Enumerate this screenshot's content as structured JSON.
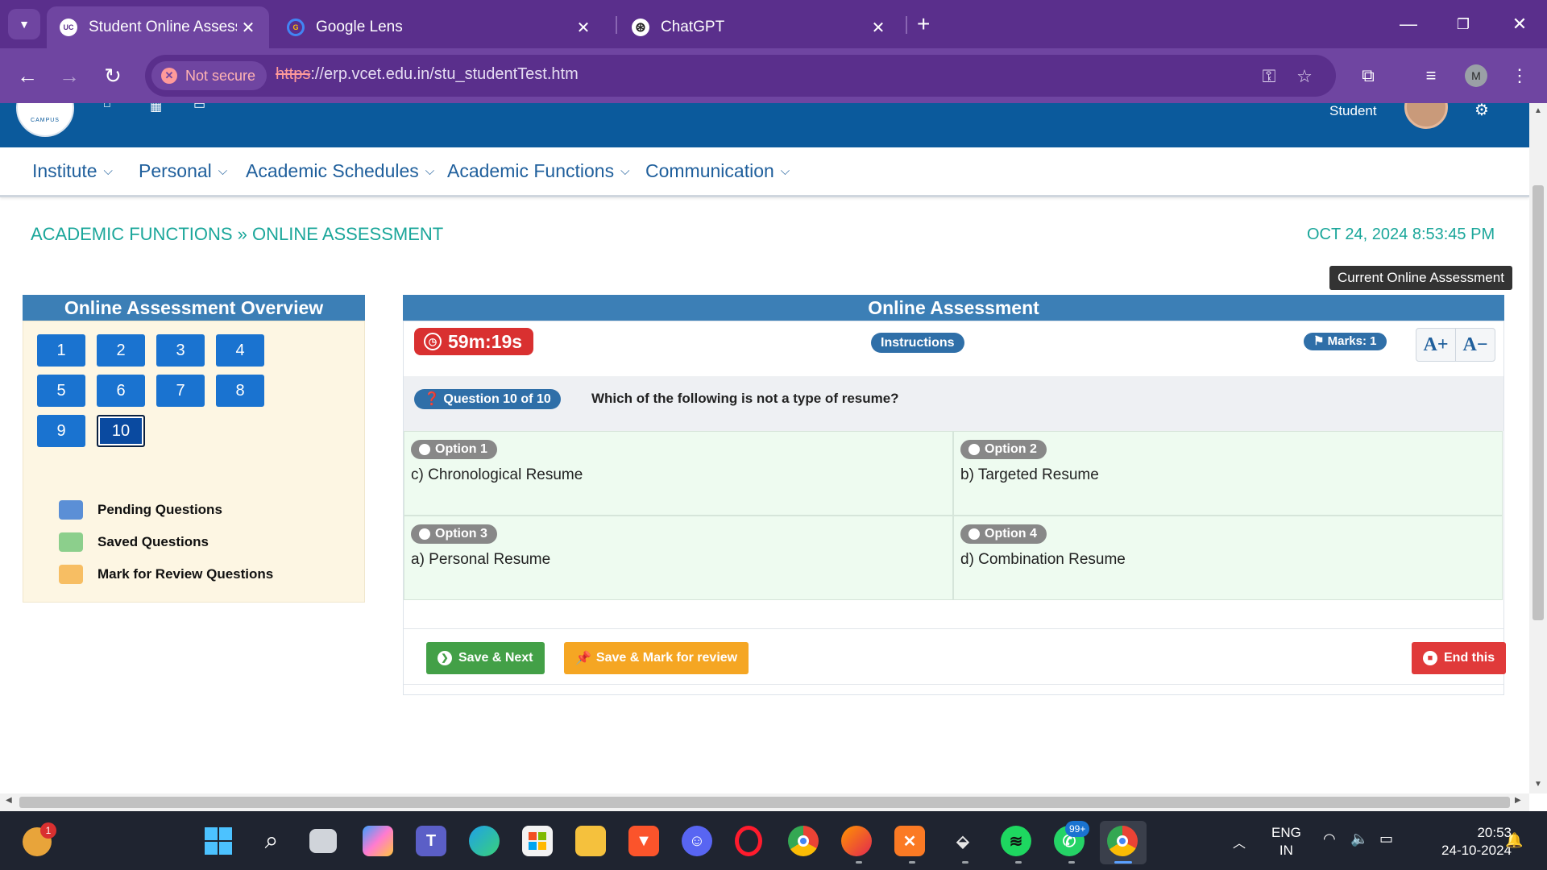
{
  "browser": {
    "tabs": [
      {
        "title": "Student Online Assessment",
        "favicon": "UC"
      },
      {
        "title": "Google Lens",
        "favicon": "G"
      },
      {
        "title": "ChatGPT",
        "favicon": "⊛"
      }
    ],
    "security_label": "Not secure",
    "url_scheme": "https",
    "url_rest": "://erp.vcet.edu.in/stu_studentTest.htm",
    "profile_initial": "M"
  },
  "header": {
    "logo_text": "CAMPUS",
    "student_label": "Student"
  },
  "menu": [
    {
      "label": "Institute"
    },
    {
      "label": "Personal"
    },
    {
      "label": "Academic Schedules"
    },
    {
      "label": "Academic Functions"
    },
    {
      "label": "Communication"
    }
  ],
  "breadcrumb": "ACADEMIC FUNCTIONS » ONLINE ASSESSMENT",
  "datetime": "OCT 24, 2024  8:53:45 PM",
  "current_assessment_label": "Current Online Assessment",
  "overview": {
    "title": "Online Assessment Overview",
    "questions": [
      "1",
      "2",
      "3",
      "4",
      "5",
      "6",
      "7",
      "8",
      "9",
      "10"
    ],
    "current": "10",
    "legend": [
      {
        "label": "Pending Questions",
        "color": "#5b8fd6"
      },
      {
        "label": "Saved Questions",
        "color": "#8ccf8c"
      },
      {
        "label": "Mark for Review Questions",
        "color": "#f7be63"
      }
    ]
  },
  "assessment": {
    "title": "Online Assessment",
    "timer": "59m:19s",
    "instructions_label": "Instructions",
    "marks_label": "Marks: 1",
    "font_increase": "A+",
    "font_decrease": "A−",
    "question_badge": "Question 10 of 10",
    "question_text": "Which of the following is not a type of resume?",
    "options": [
      {
        "tag": "Option 1",
        "text": "c) Chronological Resume"
      },
      {
        "tag": "Option 2",
        "text": "b) Targeted Resume"
      },
      {
        "tag": "Option 3",
        "text": "a) Personal Resume"
      },
      {
        "tag": "Option 4",
        "text": "d) Combination Resume"
      }
    ],
    "save_next_label": "Save & Next",
    "save_review_label": "Save & Mark for review",
    "end_label": "End this"
  },
  "taskbar": {
    "weather_badge": "1",
    "whatsapp_badge": "99+",
    "lang_line1": "ENG",
    "lang_line2": "IN",
    "time": "20:53",
    "date": "24-10-2024"
  },
  "colors": {
    "browser_frame": "#5a2f8c",
    "site_header": "#0b5a9c",
    "panel_header": "#3c7fb6",
    "accent_teal": "#1aa69a"
  }
}
